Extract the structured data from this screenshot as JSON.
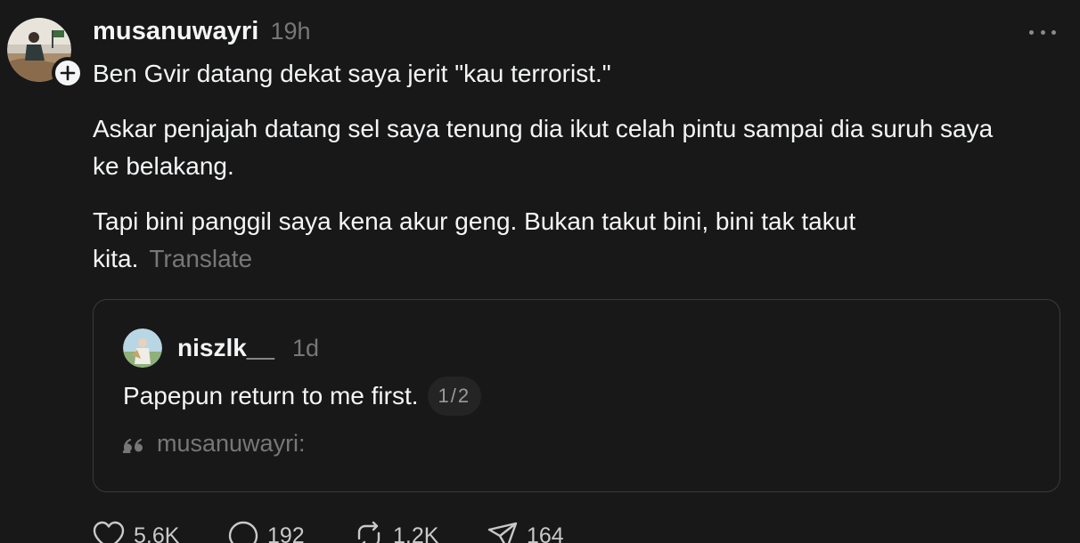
{
  "post": {
    "author": "musanuwayri",
    "time": "19h",
    "paragraphs": [
      "Ben Gvir datang dekat saya jerit \"kau terrorist.\"",
      "Askar penjajah datang sel saya tenung dia ikut celah pintu sampai dia suruh saya ke belakang.",
      "Tapi bini panggil saya kena akur geng. Bukan takut bini, bini tak takut kita."
    ],
    "translate_label": "Translate",
    "icons": {
      "avatar": "avatar-photo",
      "follow": "plus-icon",
      "more": "more-icon"
    }
  },
  "quoted": {
    "author": "niszlk__",
    "time": "1d",
    "text": "Papepun return to me first.",
    "page_indicator": "1/2",
    "reference_author": "musanuwayri:",
    "icons": {
      "reference": "quote-icon"
    }
  },
  "actions": {
    "likes": "5.6K",
    "replies": "192",
    "reposts": "1.2K",
    "shares": "164",
    "icons": [
      "heart-icon",
      "comment-icon",
      "repost-icon",
      "share-icon"
    ]
  },
  "colors": {
    "background": "#181818",
    "text": "#f3f5f7",
    "muted": "#777777",
    "border": "#3a3a3a"
  }
}
